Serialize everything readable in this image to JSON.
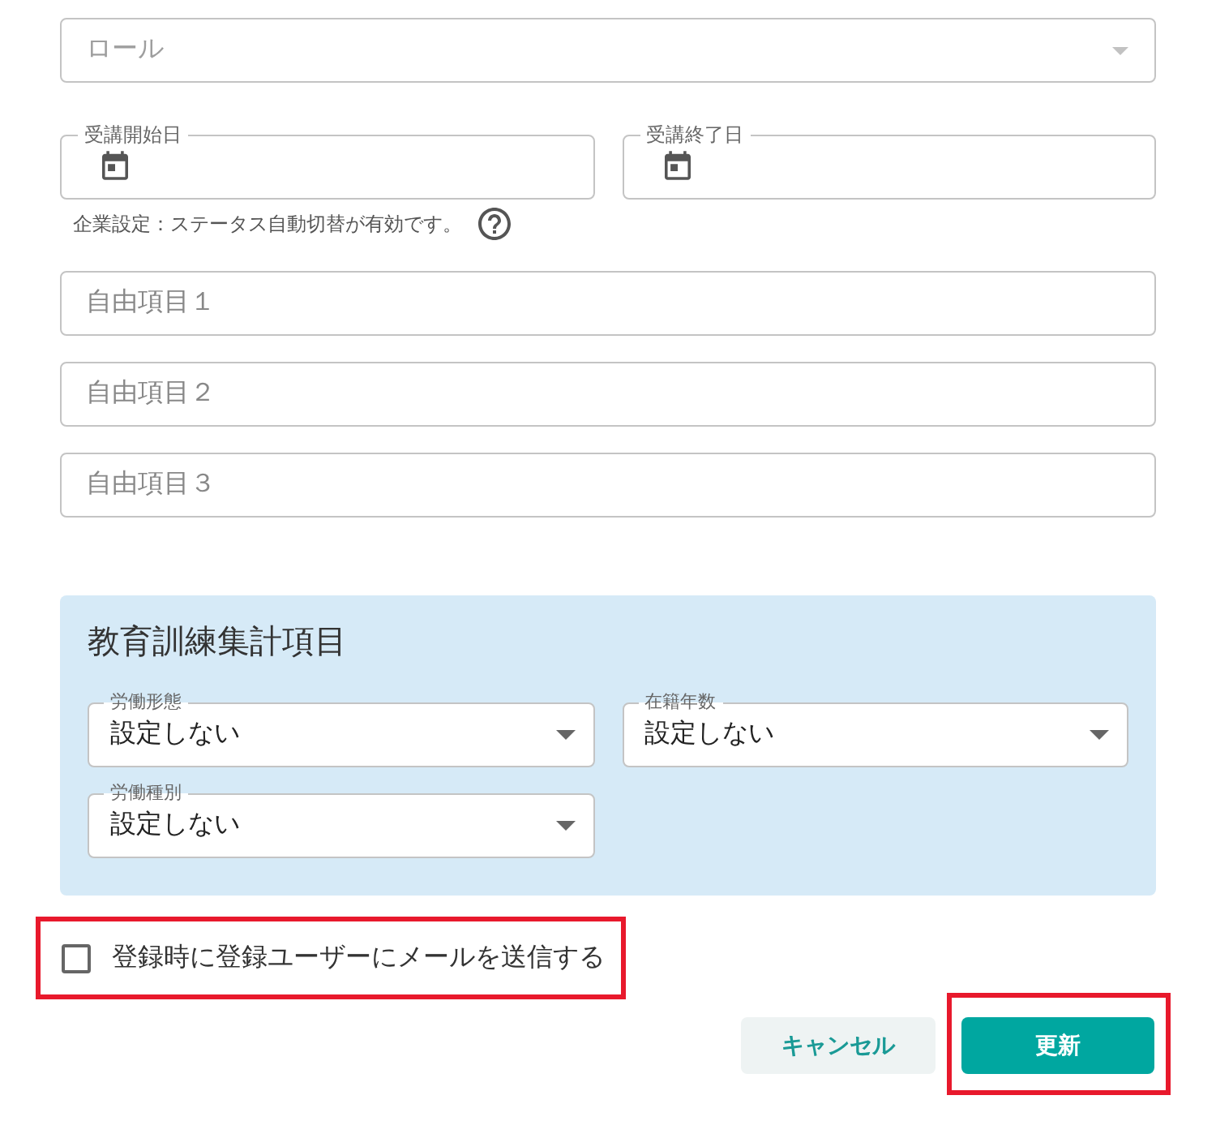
{
  "role_select": {
    "placeholder": "ロール"
  },
  "date_fields": [
    {
      "label": "受講開始日"
    },
    {
      "label": "受講終了日"
    }
  ],
  "status_note": {
    "text": "企業設定：ステータス自動切替が有効です。"
  },
  "free_fields": [
    {
      "placeholder": "自由項目１"
    },
    {
      "placeholder": "自由項目２"
    },
    {
      "placeholder": "自由項目３"
    }
  ],
  "training_section": {
    "title": "教育訓練集計項目",
    "selects": [
      {
        "label": "労働形態",
        "value": "設定しない"
      },
      {
        "label": "在籍年数",
        "value": "設定しない"
      },
      {
        "label": "労働種別",
        "value": "設定しない"
      }
    ]
  },
  "email_checkbox": {
    "label": "登録時に登録ユーザーにメールを送信する",
    "checked": false,
    "highlighted": true
  },
  "buttons": [
    {
      "kind": "secondary",
      "label": "キャンセル",
      "highlighted": false
    },
    {
      "kind": "primary",
      "label": "更新",
      "highlighted": true
    }
  ]
}
